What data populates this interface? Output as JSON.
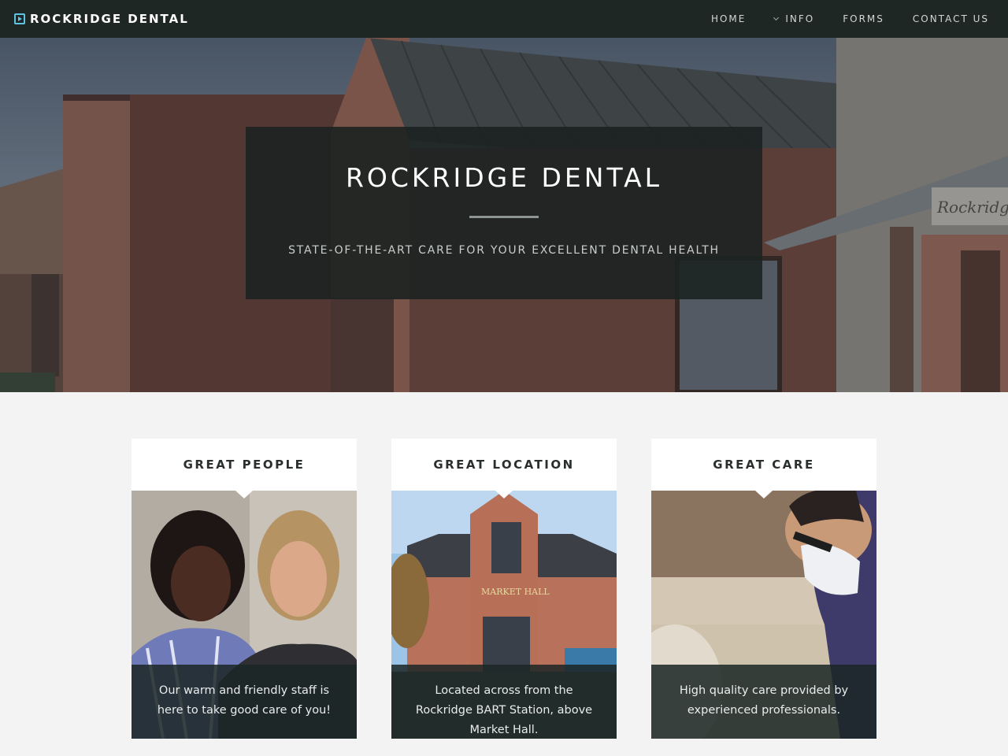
{
  "nav": {
    "brand": "ROCKRIDGE DENTAL",
    "brand_icon": "play-square-icon",
    "items": [
      {
        "label": "HOME"
      },
      {
        "label": "INFO",
        "icon": "chevron-down-icon"
      },
      {
        "label": "FORMS"
      },
      {
        "label": "CONTACT US"
      }
    ]
  },
  "hero": {
    "title": "ROCKRIDGE DENTAL",
    "subtitle": "STATE-OF-THE-ART CARE FOR YOUR EXCELLENT DENTAL HEALTH",
    "sign_text": "Rockridge"
  },
  "cards": [
    {
      "title": "GREAT PEOPLE",
      "caption": "Our warm and friendly staff is here to take good care of you!"
    },
    {
      "title": "GREAT LOCATION",
      "caption": "Located across from the Rockridge BART Station, above Market Hall.",
      "building_sign": "MARKET HALL"
    },
    {
      "title": "GREAT CARE",
      "caption": "High quality care provided by experienced professionals."
    }
  ],
  "colors": {
    "nav_bg": "#1f2725",
    "accent": "#5fc3e4",
    "page_bg": "#f3f3f3",
    "overlay": "#1c2221"
  }
}
